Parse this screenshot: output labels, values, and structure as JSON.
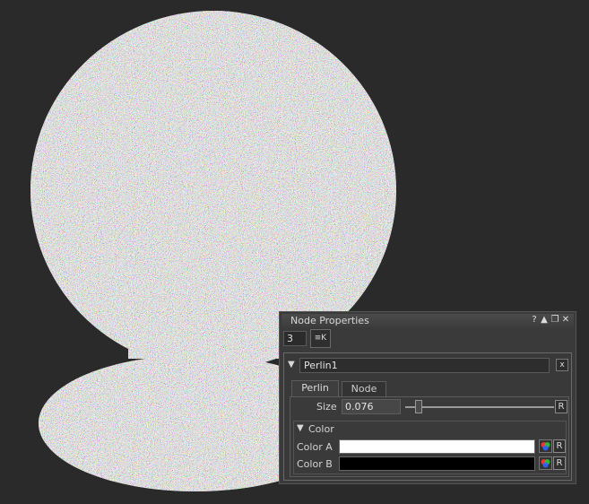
{
  "panel": {
    "title": "Node Properties",
    "title_buttons": [
      "?",
      "▲",
      "❐",
      "✕"
    ],
    "instance_count": "3",
    "pin_label": "≡K"
  },
  "node": {
    "collapse_icon": "▼",
    "name": "Perlin1",
    "close_label": "x",
    "tabs": [
      {
        "label": "Perlin",
        "active": true
      },
      {
        "label": "Node",
        "active": false
      }
    ],
    "size": {
      "label": "Size",
      "value": "0.076",
      "reset_label": "R",
      "slider_fraction": 0.076
    },
    "color_group": {
      "collapse_icon": "▼",
      "label": "Color",
      "color_a": {
        "label": "Color A",
        "value": "#ffffff",
        "reset_label": "R"
      },
      "color_b": {
        "label": "Color B",
        "value": "#000000",
        "reset_label": "R"
      }
    }
  },
  "colors": {
    "background": "#2a2a2a",
    "noise_light": "#d6d6d6",
    "noise_dark": "#222222",
    "panel_bg": "#3a3a3a"
  },
  "icons": {
    "pin": "pin-icon",
    "color_picker": "color-wheel-icon"
  }
}
